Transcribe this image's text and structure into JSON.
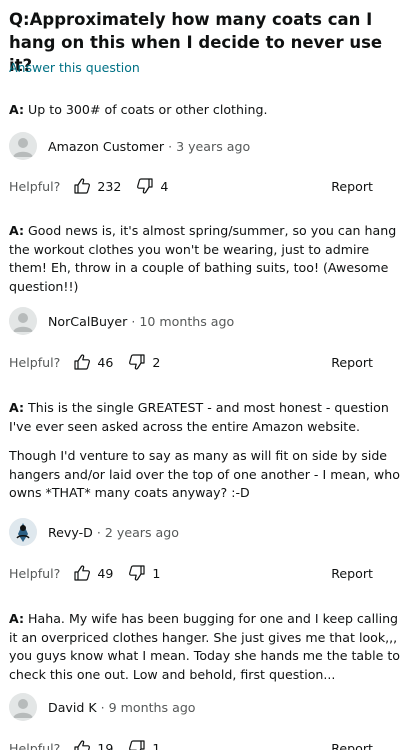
{
  "question": {
    "prefix": "Q:",
    "text": "Approximately how many coats can I hang on this when I decide to never use it?",
    "answer_link": "Answer this question"
  },
  "vote_labels": {
    "helpful": "Helpful?",
    "report": "Report"
  },
  "answers": [
    {
      "prefix": "A:",
      "paragraphs": [
        "Up to 300# of coats or other clothing."
      ],
      "author": "Amazon Customer",
      "time": "3 years ago",
      "avatar": "default-person-icon",
      "upvotes": "232",
      "downvotes": "4"
    },
    {
      "prefix": "A:",
      "paragraphs": [
        "Good news is, it's almost spring/summer, so you can hang the workout clothes you won't be wearing, just to admire them! Eh, throw in a couple of bathing suits, too! (Awesome question!!)"
      ],
      "author": "NorCalBuyer",
      "time": "10 months ago",
      "avatar": "default-person-icon",
      "upvotes": "46",
      "downvotes": "2"
    },
    {
      "prefix": "A:",
      "paragraphs": [
        "This is the single GREATEST - and most honest - question I've ever seen asked across the entire Amazon website.",
        "Though I'd venture to say as many as will fit on side by side hangers and/or laid over the top of one another - I mean, who owns *THAT* many coats anyway? :-D"
      ],
      "author": "Revy-D",
      "time": "2 years ago",
      "avatar": "profile-photo-icon",
      "upvotes": "49",
      "downvotes": "1"
    },
    {
      "prefix": "A:",
      "paragraphs": [
        "Haha. My wife has been bugging for one and I keep calling it an overpriced clothes hanger. She just gives me that look,,, you guys know what I mean. Today she hands me the table to check this one out. Low and behold, first question..."
      ],
      "author": "David K",
      "time": "9 months ago",
      "avatar": "default-person-icon",
      "upvotes": "19",
      "downvotes": "1"
    }
  ]
}
